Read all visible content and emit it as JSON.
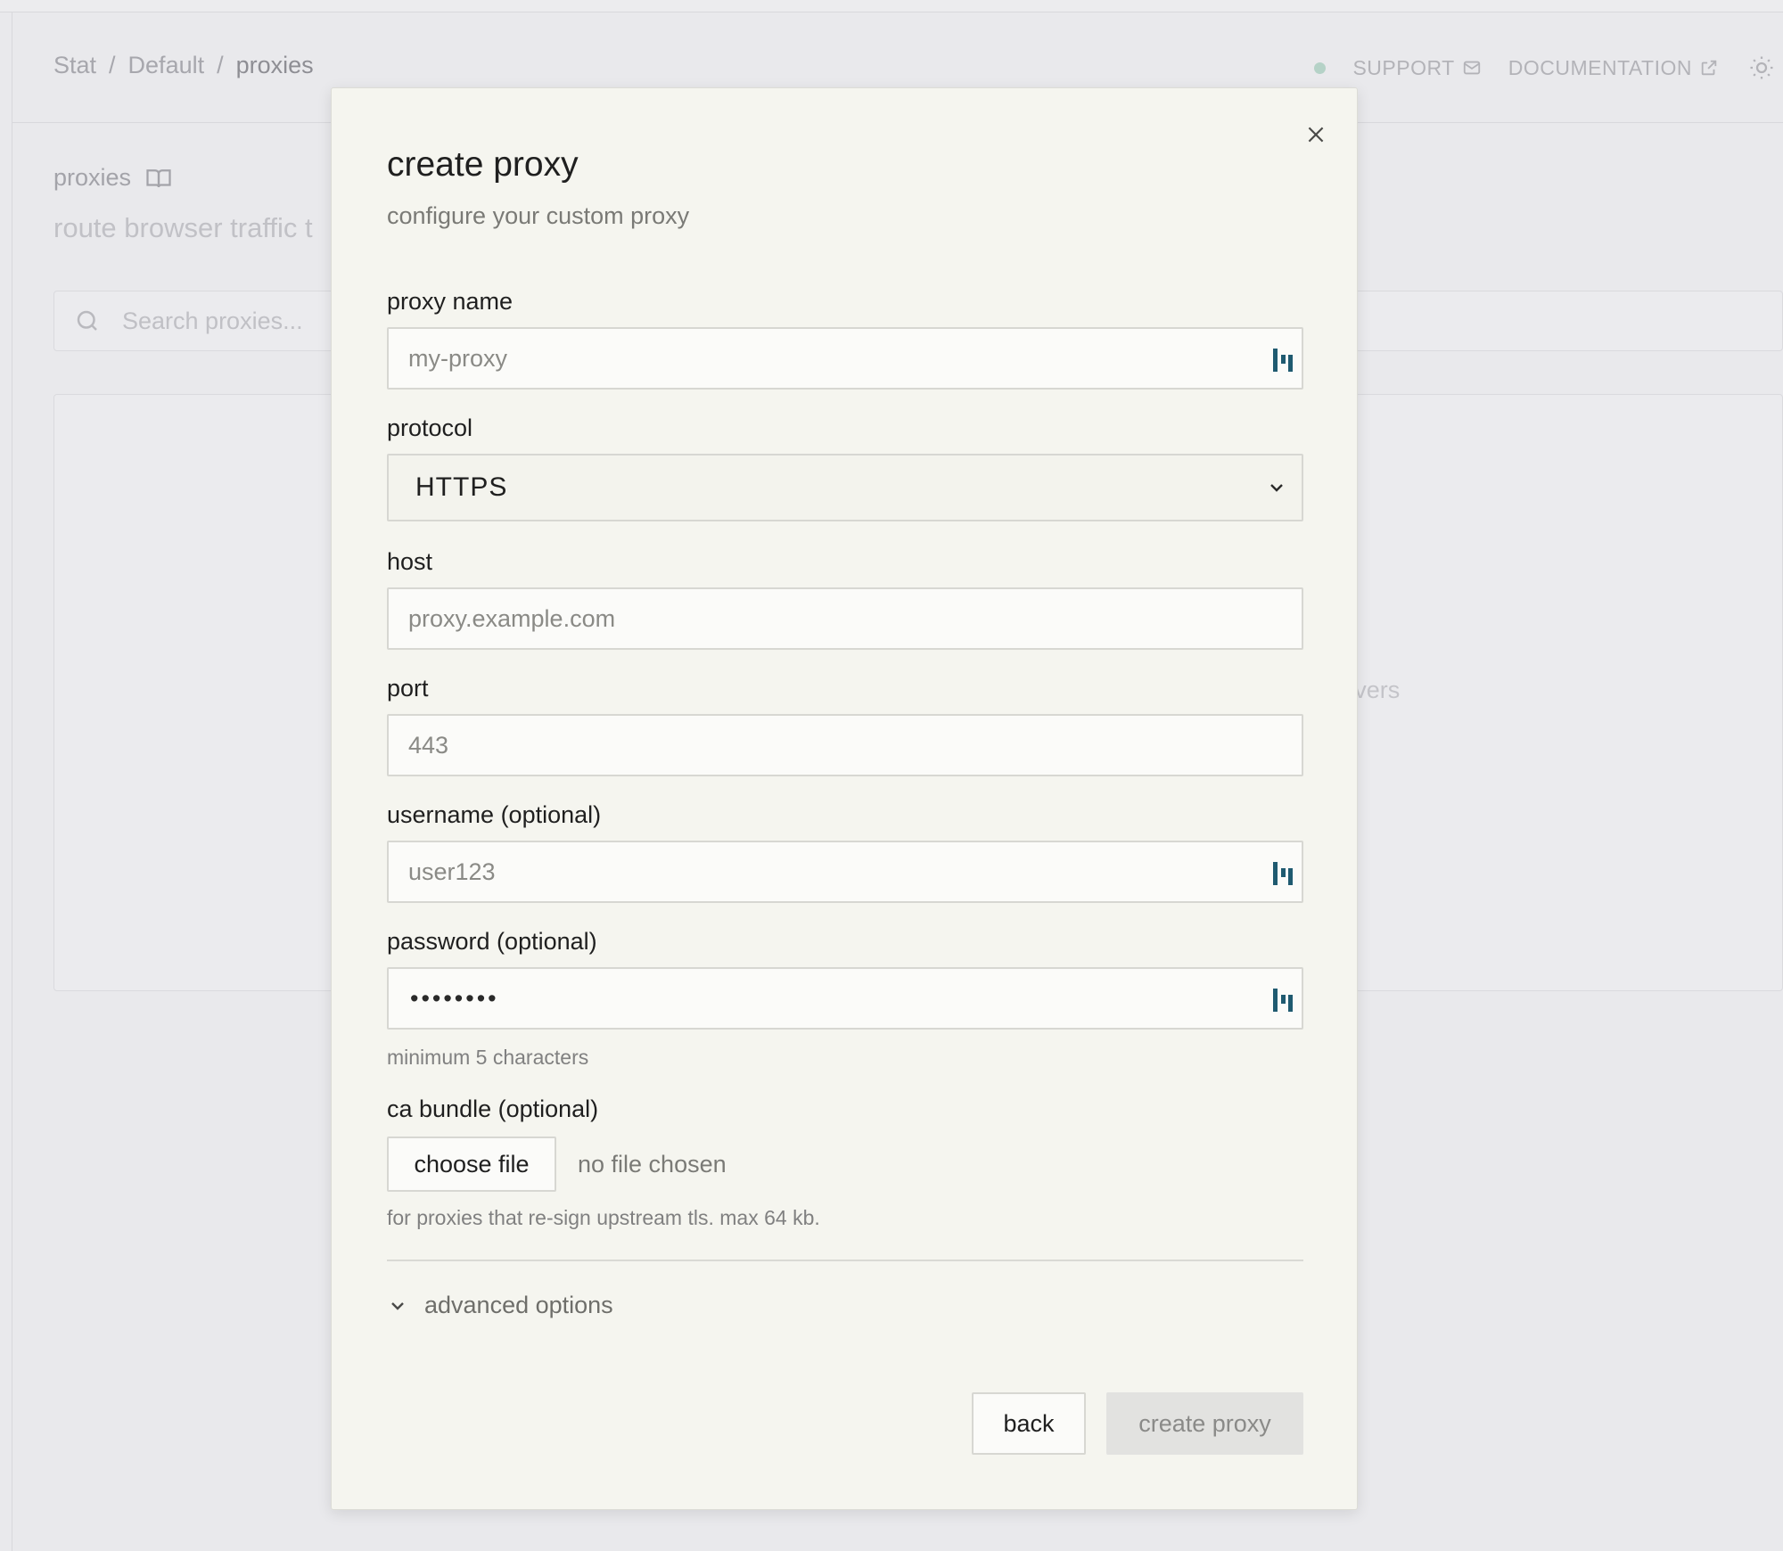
{
  "breadcrumb": {
    "items": [
      "Stat",
      "Default",
      "proxies"
    ],
    "separator": "/"
  },
  "header": {
    "support_label": "SUPPORT",
    "documentation_label": "DOCUMENTATION",
    "status_color": "#b5d2c7"
  },
  "page": {
    "title": "proxies",
    "subtitle": "route browser traffic t",
    "search_placeholder": "Search proxies...",
    "empty_text_fragment": "obile, or custom servers"
  },
  "modal": {
    "title": "create proxy",
    "subtitle": "configure your custom proxy",
    "fields": {
      "proxy_name": {
        "label": "proxy name",
        "placeholder": "my-proxy"
      },
      "protocol": {
        "label": "protocol",
        "value": "HTTPS"
      },
      "host": {
        "label": "host",
        "placeholder": "proxy.example.com"
      },
      "port": {
        "label": "port",
        "placeholder": "443"
      },
      "username": {
        "label": "username (optional)",
        "placeholder": "user123"
      },
      "password": {
        "label": "password (optional)",
        "masked_value": "••••••••",
        "hint": "minimum 5 characters"
      },
      "ca_bundle": {
        "label": "ca bundle (optional)",
        "button_label": "choose file",
        "status": "no file chosen",
        "hint": "for proxies that re-sign upstream tls. max 64 kb."
      }
    },
    "advanced_label": "advanced options",
    "back_label": "back",
    "create_label": "create proxy"
  },
  "colors": {
    "modal_bg": "#f5f5ef",
    "overlay_bg": "#e9e9ec",
    "password_manager_icon": "#1f5a70"
  },
  "icons": {
    "close": "close-icon",
    "chevron": "chevron-down-icon",
    "password_manager": "password-manager-icon",
    "search": "search-icon",
    "book": "book-icon",
    "mail": "mail-icon",
    "external_link": "external-link-icon",
    "theme": "sun-icon"
  }
}
